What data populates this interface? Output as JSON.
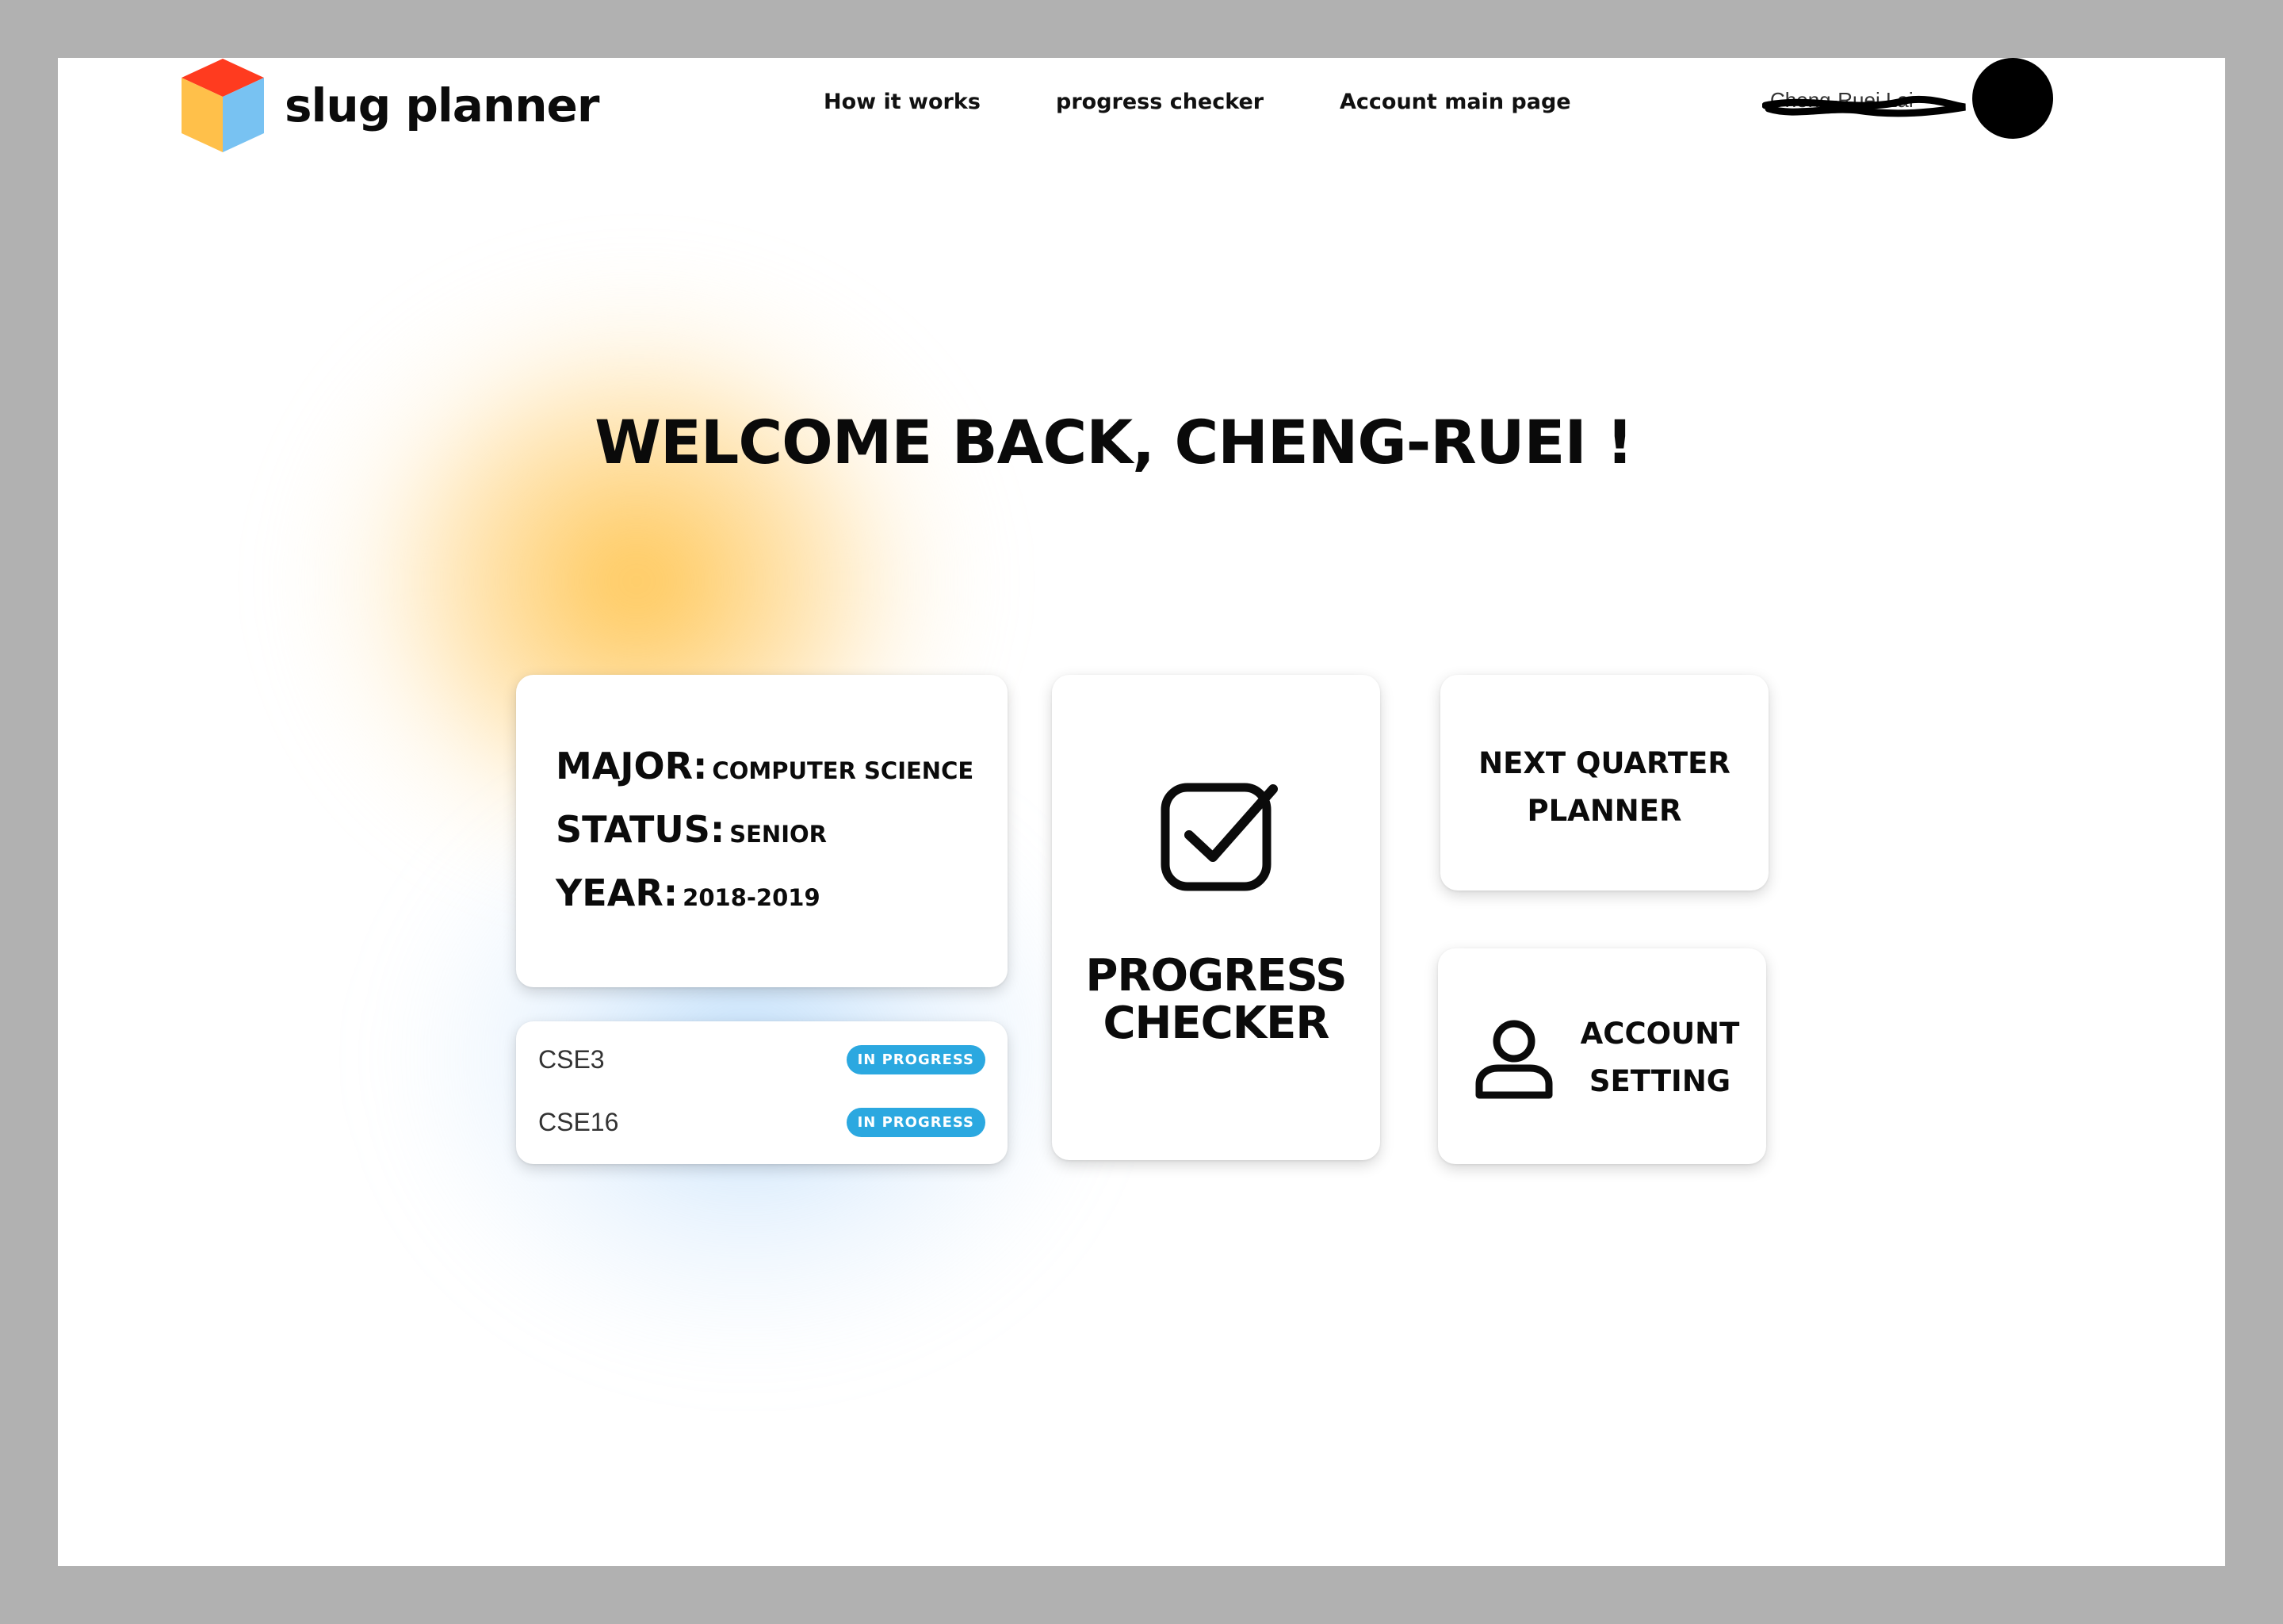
{
  "nav": {
    "brand": "slug planner",
    "links": [
      "How it works",
      "progress checker",
      "Account main page"
    ],
    "user_name": "Cheng-Ruei Lai"
  },
  "welcome": "WELCOME BACK, CHENG-RUEI !",
  "profile": {
    "major_label": "MAJOR:",
    "major_value": "COMPUTER SCIENCE",
    "status_label": "STATUS:",
    "status_value": "SENIOR",
    "year_label": "YEAR:",
    "year_value": "2018-2019"
  },
  "courses": [
    {
      "name": "CSE3",
      "status": "IN PROGRESS"
    },
    {
      "name": "CSE16",
      "status": "IN PROGRESS"
    }
  ],
  "tiles": {
    "progress_line1": "PROGRESS",
    "progress_line2": "CHECKER",
    "next_line1": "NEXT QUARTER",
    "next_line2": "PLANNER",
    "account_line1": "ACCOUNT",
    "account_line2": "SETTING"
  },
  "icons": {
    "logo": "cube-logo-icon",
    "progress": "checkbox-check-icon",
    "account": "person-icon"
  },
  "colors": {
    "badge": "#2ba8e0",
    "glow_yellow": "#ffc44d",
    "glow_blue": "#8cc3f5",
    "cube_red": "#ff3b1f",
    "cube_yellow": "#ffc04a",
    "cube_blue": "#78c2f2"
  }
}
